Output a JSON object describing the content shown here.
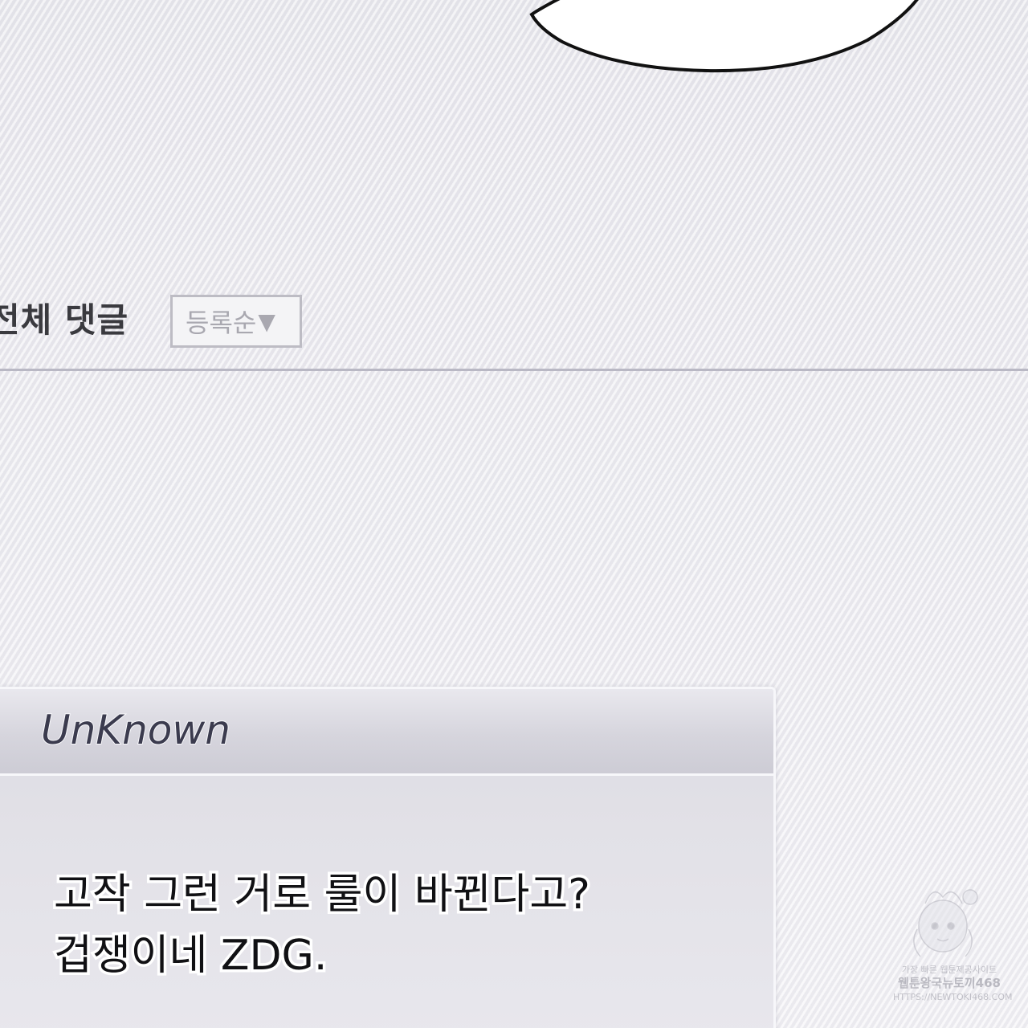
{
  "comments_section": {
    "title": "전체 댓글",
    "sort": {
      "selected": "등록순",
      "arrow": "▼"
    }
  },
  "comment": {
    "author": "UnKnown",
    "lines": [
      "고작 그런 거로 룰이 바뀐다고?",
      "겁쟁이네 ZDG."
    ]
  },
  "watermark": {
    "line1": "가장 빠른 웹툰제공사이트",
    "line2": "웹툰왕국뉴토끼468",
    "line3": "HTTPS://NEWTOKI468.COM"
  },
  "colors": {
    "background": "#ecebf0",
    "title_text": "#3a3a3f",
    "divider": "#b9b8c4",
    "author_text": "#3b3b4e",
    "body_text": "#111114"
  }
}
